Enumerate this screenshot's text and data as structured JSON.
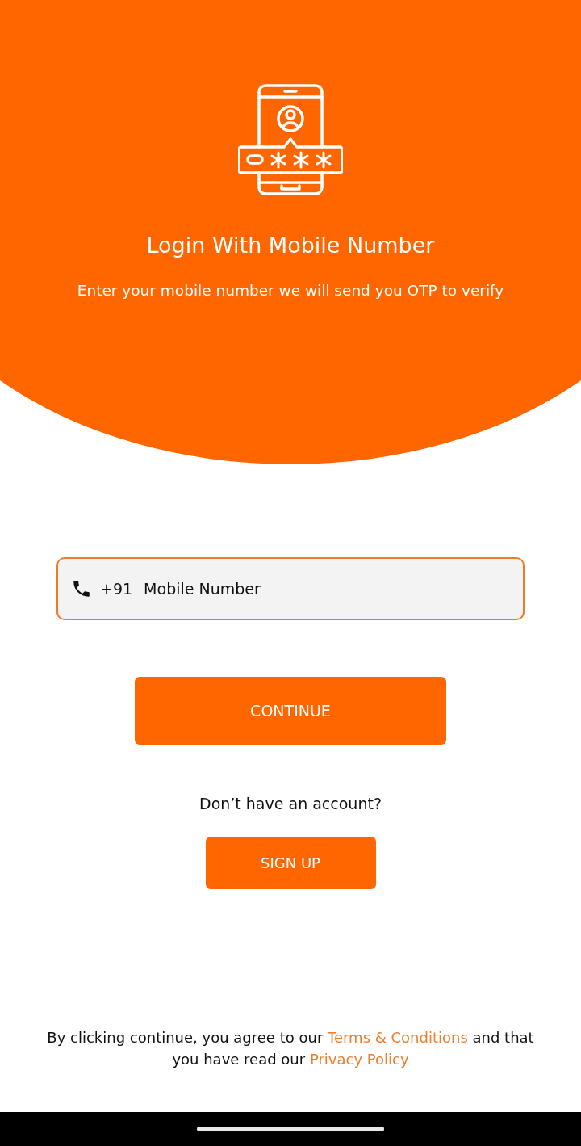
{
  "header": {
    "title": "Login With Mobile Number",
    "subtitle": "Enter your mobile number we will send you OTP to verify"
  },
  "phone_field": {
    "prefix": "+91",
    "placeholder": "Mobile Number"
  },
  "continue_button": "CONTINUE",
  "signup_prompt": "Don’t have an account?",
  "signup_button": "SIGN UP",
  "footer": {
    "text_before": "By clicking continue, you agree to our",
    "terms_link": "Terms & Conditions",
    "text_middle": "and that you have read our",
    "privacy_link": "Privacy Policy"
  }
}
